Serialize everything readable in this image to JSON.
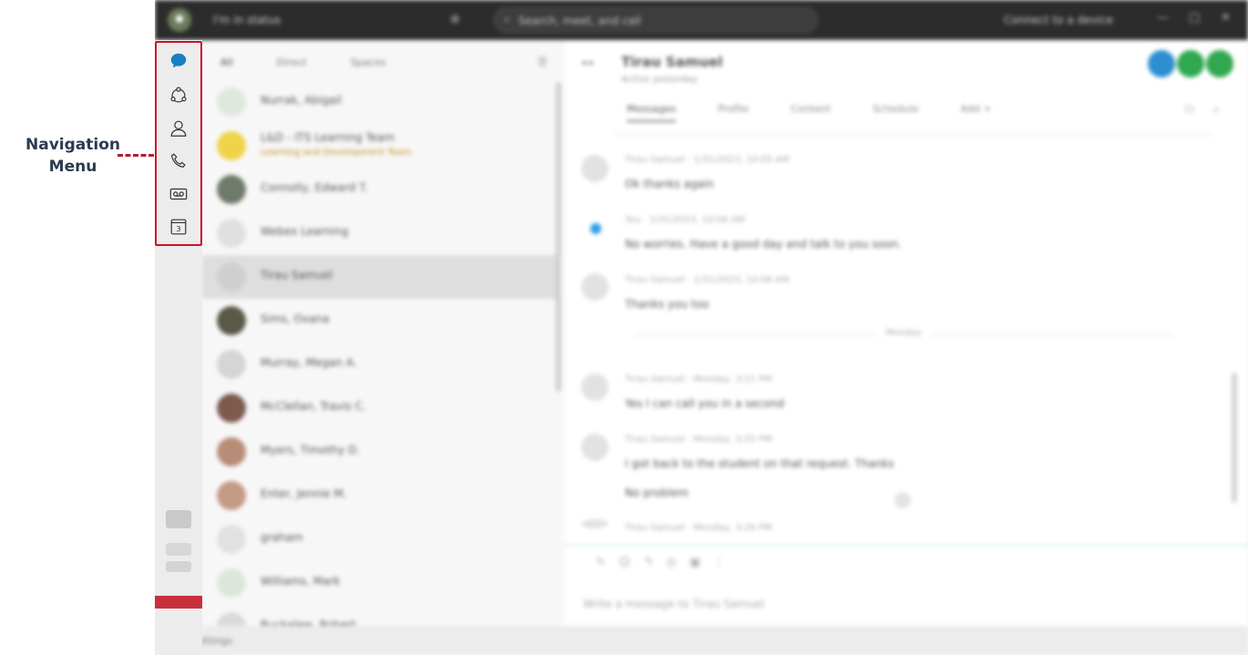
{
  "annotation": {
    "label_line1": "Navigation",
    "label_line2": "Menu",
    "color": "#b01c38"
  },
  "titlebar": {
    "status": "I'm in status",
    "search_placeholder": "Search, meet, and call",
    "connect_label": "Connect to a device"
  },
  "rail": {
    "items": [
      {
        "icon": "chat-bubble-icon",
        "label": "Messages",
        "active": true,
        "accent": "#1a7fc1"
      },
      {
        "icon": "meetings-icon",
        "label": "Meetings"
      },
      {
        "icon": "contacts-icon",
        "label": "Contacts"
      },
      {
        "icon": "phone-icon",
        "label": "Calls"
      },
      {
        "icon": "voicemail-icon",
        "label": "Voicemail"
      },
      {
        "icon": "calendar-icon",
        "label": "Calendar",
        "day": "3"
      }
    ]
  },
  "list": {
    "filters": [
      "All",
      "Direct",
      "Spaces"
    ],
    "conversations": [
      {
        "name": "Nurrak, Abigail",
        "sub": ""
      },
      {
        "name": "L&D - ITS Learning Team",
        "sub": "Learning and Development Team"
      },
      {
        "name": "Connolly, Edward T.",
        "sub": ""
      },
      {
        "name": "Webex Learning",
        "sub": ""
      },
      {
        "name": "Tirau Samuel",
        "sub": "",
        "selected": true
      },
      {
        "name": "Sims, Oxana",
        "sub": ""
      },
      {
        "name": "Murray, Megan A.",
        "sub": ""
      },
      {
        "name": "McClellan, Travis C.",
        "sub": ""
      },
      {
        "name": "Myers, Timothy D.",
        "sub": ""
      },
      {
        "name": "Enter, Jennie M.",
        "sub": ""
      },
      {
        "name": "graham",
        "sub": ""
      },
      {
        "name": "Williams, Mark",
        "sub": ""
      },
      {
        "name": "Buckalew, Robert",
        "sub": ""
      }
    ]
  },
  "chat": {
    "title": "Tirau Samuel",
    "subtitle": "Active yesterday",
    "tabs": [
      "Messages",
      "Profile",
      "Content",
      "Schedule",
      "Add +"
    ],
    "messages": [
      {
        "meta": "Tirau Samuel · 1/31/2023, 10:05 AM",
        "text": "Ok thanks again"
      },
      {
        "meta": "You · 1/31/2023, 10:06 AM",
        "text": "No worries. Have a good day and talk to you soon."
      },
      {
        "meta": "Tirau Samuel · 1/31/2023, 10:06 AM",
        "text": "Thanks you too"
      },
      {
        "meta": "Tirau Samuel · Monday, 3:21 PM",
        "text": "Yes I can call you in a second"
      },
      {
        "meta": "Tirau Samuel · Monday, 3:25 PM",
        "text": "I got back to the student on that request. Thanks",
        "text2": "No problem"
      },
      {
        "meta": "Tirau Samuel · Monday, 3:26 PM",
        "text": ""
      }
    ],
    "day_label": "Monday",
    "compose_placeholder": "Write a message to Tirau Samuel"
  },
  "footer": {
    "text": "Call Settings"
  }
}
